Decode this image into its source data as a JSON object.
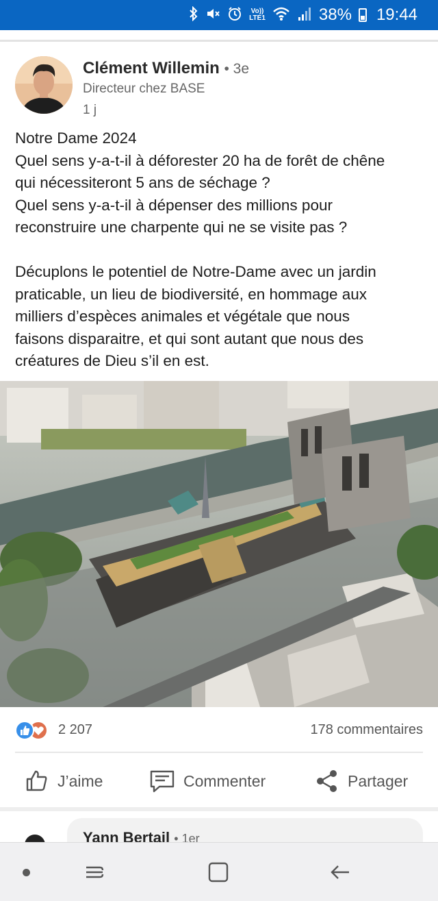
{
  "status_bar": {
    "icons": [
      "bluetooth-icon",
      "mute-icon",
      "alarm-icon",
      "volte-icon",
      "wifi-icon",
      "signal-icon"
    ],
    "lte_label_top": "Vo))",
    "lte_label_bottom": "LTE1",
    "battery": "38%",
    "battery_level": 0.38,
    "time": "19:44",
    "color": "#0a66c2"
  },
  "post": {
    "author": {
      "name": "Clément Willemin",
      "degree": "• 3e",
      "title": "Directeur chez BASE",
      "time": "1 j"
    },
    "text_lines": {
      "l1": "Notre Dame 2024",
      "l2": "Quel sens y-a-t-il à déforester 20 ha de forêt de chêne",
      "l3": "qui nécessiteront 5 ans de séchage ?",
      "l4": "Quel sens y-a-t-il à dépenser des millions pour",
      "l5": "reconstruire une charpente qui ne se visite pas ?",
      "l6": "Décuplons le potentiel de Notre-Dame avec un jardin",
      "l7": "praticable, un lieu de biodiversité, en hommage aux",
      "l8": "milliers d’espèces animales et végétale que nous",
      "l9": "faisons disparaitre, et qui sont autant que nous des",
      "l10": "créatures de Dieu s’il en est."
    },
    "reactions": {
      "count": "2 207",
      "icons": [
        "like-reaction-icon",
        "love-reaction-icon"
      ]
    },
    "comments": "178 commentaires",
    "actions": {
      "like": "J’aime",
      "comment": "Commenter",
      "share": "Partager"
    }
  },
  "comment_preview": {
    "name": "Yann Bertail",
    "degree": "• 1er"
  },
  "nav_bar": {
    "buttons": [
      "nav-dot-icon",
      "recent-apps-icon",
      "home-icon",
      "back-icon"
    ]
  }
}
